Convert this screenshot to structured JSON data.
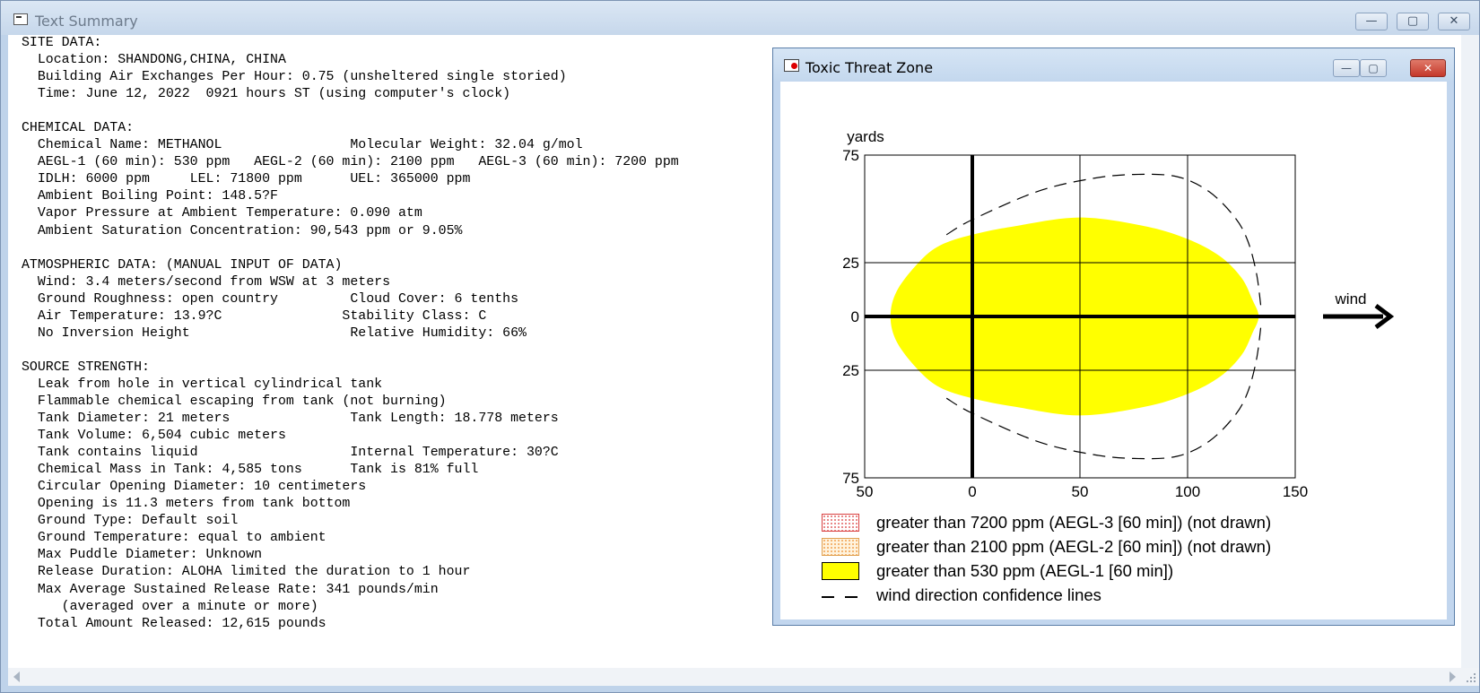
{
  "window": {
    "title": "Text Summary",
    "buttons": {
      "minimize": "—",
      "maximize": "▢",
      "close": "✕"
    }
  },
  "report": {
    "lines": [
      "SITE DATA:",
      "  Location: SHANDONG,CHINA, CHINA",
      "  Building Air Exchanges Per Hour: 0.75 (unsheltered single storied)",
      "  Time: June 12, 2022  0921 hours ST (using computer's clock)",
      "",
      "CHEMICAL DATA:",
      "  Chemical Name: METHANOL                Molecular Weight: 32.04 g/mol",
      "  AEGL-1 (60 min): 530 ppm   AEGL-2 (60 min): 2100 ppm   AEGL-3 (60 min): 7200 ppm",
      "  IDLH: 6000 ppm     LEL: 71800 ppm      UEL: 365000 ppm",
      "  Ambient Boiling Point: 148.5?F",
      "  Vapor Pressure at Ambient Temperature: 0.090 atm",
      "  Ambient Saturation Concentration: 90,543 ppm or 9.05%",
      "",
      "ATMOSPHERIC DATA: (MANUAL INPUT OF DATA)",
      "  Wind: 3.4 meters/second from WSW at 3 meters",
      "  Ground Roughness: open country         Cloud Cover: 6 tenths",
      "  Air Temperature: 13.9?C               Stability Class: C",
      "  No Inversion Height                    Relative Humidity: 66%",
      "",
      "SOURCE STRENGTH:",
      "  Leak from hole in vertical cylindrical tank",
      "  Flammable chemical escaping from tank (not burning)",
      "  Tank Diameter: 21 meters               Tank Length: 18.778 meters",
      "  Tank Volume: 6,504 cubic meters",
      "  Tank contains liquid                   Internal Temperature: 30?C",
      "  Chemical Mass in Tank: 4,585 tons      Tank is 81% full",
      "  Circular Opening Diameter: 10 centimeters",
      "  Opening is 11.3 meters from tank bottom",
      "  Ground Type: Default soil",
      "  Ground Temperature: equal to ambient",
      "  Max Puddle Diameter: Unknown",
      "  Release Duration: ALOHA limited the duration to 1 hour",
      "  Max Average Sustained Release Rate: 341 pounds/min",
      "     (averaged over a minute or more)",
      "  Total Amount Released: 12,615 pounds"
    ]
  },
  "threat_window": {
    "title": "Toxic Threat Zone",
    "buttons": {
      "minimize": "—",
      "maximize": "▢",
      "close": "✕"
    },
    "wind_label": "wind",
    "legend": [
      {
        "key": "a3",
        "label": "greater than 7200 ppm (AEGL-3 [60 min]) (not drawn)",
        "color": "#ff0000"
      },
      {
        "key": "a2",
        "label": "greater than 2100 ppm (AEGL-2 [60 min]) (not drawn)",
        "color": "#ffa500"
      },
      {
        "key": "a1",
        "label": "greater than 530 ppm (AEGL-1 [60 min])",
        "color": "#ffff00"
      },
      {
        "key": "dash",
        "label": "wind direction confidence lines",
        "color": "#000000"
      }
    ]
  },
  "chart_data": {
    "type": "area",
    "xlabel": "yards",
    "ylabel": "yards",
    "xlim": [
      -50,
      150
    ],
    "ylim": [
      -75,
      75
    ],
    "x_ticks": [
      -50,
      0,
      50,
      100,
      150
    ],
    "x_tick_labels": [
      "50",
      "0",
      "50",
      "100",
      "150"
    ],
    "y_ticks": [
      75,
      25,
      0,
      -25,
      -75
    ],
    "y_tick_labels": [
      "75",
      "25",
      "0",
      "25",
      "75"
    ],
    "grid": true,
    "series": [
      {
        "name": "greater than 530 ppm (AEGL-1 [60 min])",
        "fill": "#ffff00",
        "points": [
          [
            -38,
            0
          ],
          [
            -35,
            12
          ],
          [
            -25,
            25
          ],
          [
            -15,
            33
          ],
          [
            0,
            38
          ],
          [
            20,
            42
          ],
          [
            50,
            46
          ],
          [
            80,
            42
          ],
          [
            100,
            36
          ],
          [
            115,
            28
          ],
          [
            125,
            18
          ],
          [
            130,
            8
          ],
          [
            133,
            0
          ],
          [
            130,
            -8
          ],
          [
            125,
            -18
          ],
          [
            115,
            -28
          ],
          [
            100,
            -36
          ],
          [
            80,
            -42
          ],
          [
            50,
            -46
          ],
          [
            20,
            -42
          ],
          [
            0,
            -38
          ],
          [
            -15,
            -33
          ],
          [
            -25,
            -25
          ],
          [
            -35,
            -12
          ]
        ]
      },
      {
        "name": "wind direction confidence lines",
        "dashed": true,
        "points_upper": [
          [
            -12,
            38
          ],
          [
            0,
            45
          ],
          [
            30,
            58
          ],
          [
            55,
            64
          ],
          [
            75,
            66
          ],
          [
            95,
            65
          ],
          [
            110,
            58
          ],
          [
            122,
            46
          ],
          [
            128,
            35
          ],
          [
            132,
            20
          ],
          [
            134,
            5
          ]
        ],
        "points_lower": [
          [
            -12,
            -38
          ],
          [
            0,
            -45
          ],
          [
            30,
            -58
          ],
          [
            55,
            -64
          ],
          [
            75,
            -66
          ],
          [
            95,
            -65
          ],
          [
            110,
            -58
          ],
          [
            122,
            -46
          ],
          [
            128,
            -35
          ],
          [
            132,
            -20
          ],
          [
            134,
            -5
          ]
        ]
      }
    ]
  }
}
